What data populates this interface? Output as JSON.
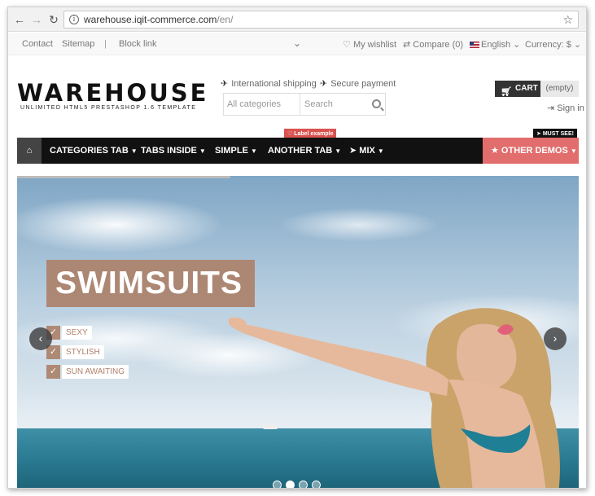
{
  "browser": {
    "url_host": "warehouse.iqit-commerce.com",
    "url_path": "/en/"
  },
  "topbar": {
    "links": [
      "Contact",
      "Sitemap",
      "|",
      "Block link"
    ],
    "wishlist": "My wishlist",
    "compare": "Compare (0)",
    "language": "English",
    "currency": "Currency: $"
  },
  "header": {
    "logo_title": "WAREHOUSE",
    "logo_subtitle": "UNLIMITED HTML5 PRESTASHOP 1.6 TEMPLATE",
    "shipping": "International shipping",
    "payment": "Secure payment",
    "search_category": "All categories",
    "search_placeholder": "Search",
    "cart_label": "CART",
    "cart_status": "(empty)",
    "signin": "Sign in"
  },
  "menu": {
    "items": [
      "CATEGORIES TAB",
      "TABS INSIDE",
      "SIMPLE",
      "ANOTHER TAB",
      "MIX"
    ],
    "other": "OTHER DEMOS",
    "label_example": "Label example",
    "must_see": "MUST SEE!"
  },
  "slider": {
    "title": "SWIMSUITS",
    "features": [
      "SEXY",
      "STYLISH",
      "SUN AWAITING"
    ],
    "progress_fraction": 0.38,
    "slide_count": 4,
    "active_slide": 2
  },
  "colors": {
    "accent": "#e26d6d",
    "menu_bg": "#111111",
    "slide_tag": "#ac846e",
    "label_red": "#d9534f"
  }
}
